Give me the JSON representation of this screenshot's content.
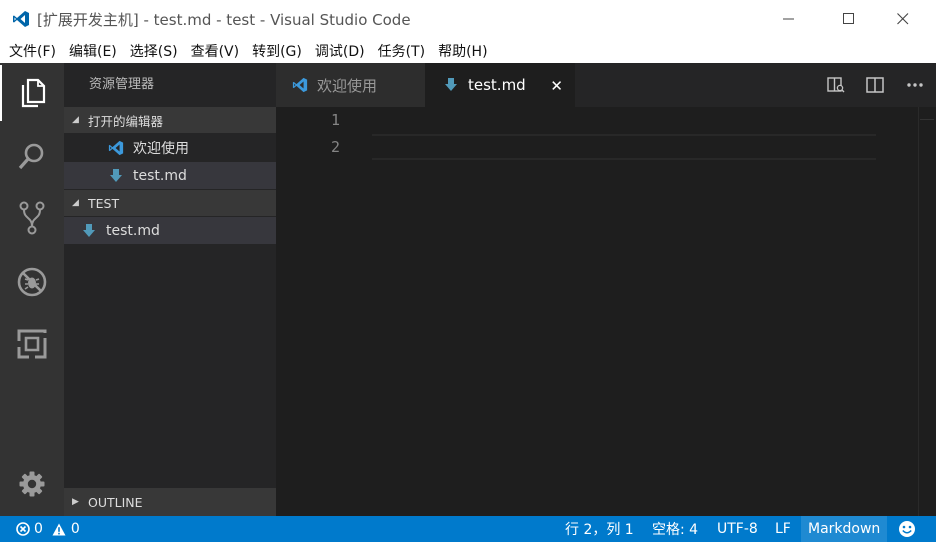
{
  "window": {
    "title": "[扩展开发主机] - test.md - test - Visual Studio Code",
    "icon": "vscode-logo-icon"
  },
  "menu": [
    {
      "label": "文件(F)"
    },
    {
      "label": "编辑(E)"
    },
    {
      "label": "选择(S)"
    },
    {
      "label": "查看(V)"
    },
    {
      "label": "转到(G)"
    },
    {
      "label": "调试(D)"
    },
    {
      "label": "任务(T)"
    },
    {
      "label": "帮助(H)"
    }
  ],
  "activitybar": {
    "items": [
      "explorer-icon",
      "search-icon",
      "source-control-icon",
      "debug-icon",
      "extensions-icon"
    ],
    "bottom": "settings-gear-icon"
  },
  "sidebar": {
    "title": "资源管理器",
    "open_editors": {
      "header": "打开的编辑器",
      "items": [
        {
          "label": "欢迎使用",
          "icon": "vscode-logo-icon"
        },
        {
          "label": "test.md",
          "icon": "markdown-icon"
        }
      ]
    },
    "folder": {
      "header": "TEST",
      "items": [
        {
          "label": "test.md",
          "icon": "markdown-icon"
        }
      ]
    },
    "outline": {
      "header": "OUTLINE"
    }
  },
  "tabs": [
    {
      "label": "欢迎使用",
      "active": false
    },
    {
      "label": "test.md",
      "active": true
    }
  ],
  "editor": {
    "line_numbers": [
      "1",
      "2"
    ]
  },
  "status": {
    "errors": "0",
    "warnings": "0",
    "cursor": "行 2，列 1",
    "indent": "空格: 4",
    "encoding": "UTF-8",
    "eol": "LF",
    "language": "Markdown",
    "feedback_icon": "smiley-icon"
  },
  "colors": {
    "accent": "#007acc",
    "markdown_icon": "#519aba",
    "vscode_blue": "#0065a9"
  }
}
